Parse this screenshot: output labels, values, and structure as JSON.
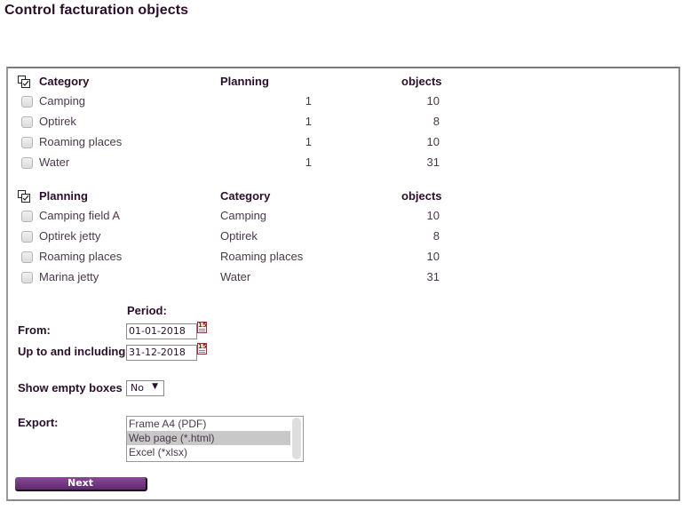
{
  "page": {
    "title": "Control facturation objects"
  },
  "category_table": {
    "headers": {
      "name": "Category",
      "planning": "Planning",
      "objects": "objects"
    },
    "rows": [
      {
        "name": "Camping",
        "planning": "1",
        "objects": "10",
        "checked": false
      },
      {
        "name": "Optirek",
        "planning": "1",
        "objects": "8",
        "checked": false
      },
      {
        "name": "Roaming places",
        "planning": "1",
        "objects": "10",
        "checked": false
      },
      {
        "name": "Water",
        "planning": "1",
        "objects": "31",
        "checked": false
      }
    ]
  },
  "planning_table": {
    "headers": {
      "name": "Planning",
      "category": "Category",
      "objects": "objects"
    },
    "rows": [
      {
        "name": "Camping field A",
        "category": "Camping",
        "objects": "10",
        "checked": false
      },
      {
        "name": "Optirek jetty",
        "category": "Optirek",
        "objects": "8",
        "checked": false
      },
      {
        "name": "Roaming places",
        "category": "Roaming places",
        "objects": "10",
        "checked": false
      },
      {
        "name": "Marina jetty",
        "category": "Water",
        "objects": "31",
        "checked": false
      }
    ]
  },
  "period": {
    "label": "Period:",
    "from_label": "From:",
    "from_value": "01-01-2018",
    "to_label": "Up to and including:",
    "to_value": "31-12-2018",
    "calendar_day": "15"
  },
  "show_empty": {
    "label": "Show empty boxes",
    "value": "No",
    "arrow": "▼"
  },
  "export": {
    "label": "Export:",
    "options": [
      "Frame A4 (PDF)",
      "Web page (*.html)",
      "Excel (*xlsx)"
    ],
    "selected": "Web page (*.html)"
  },
  "actions": {
    "next_label": "Next"
  },
  "colors": {
    "accent": "#6b3479",
    "text": "#2a0f2a"
  }
}
